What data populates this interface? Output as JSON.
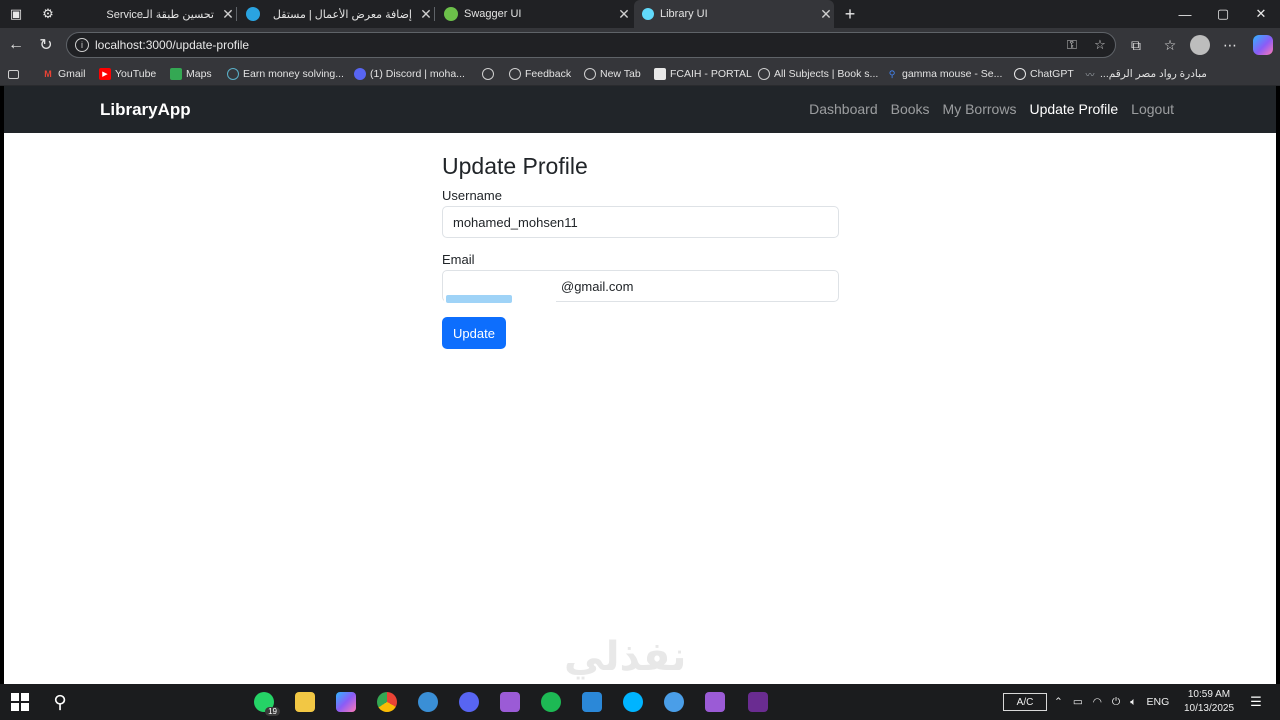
{
  "browser": {
    "tabs": [
      {
        "title": "تحسين طبقة الـService",
        "favicon_color": "#bbbbbb",
        "active": false
      },
      {
        "title": "إضافة معرض الأعمال | مستقل",
        "favicon_color": "#2aa3e0",
        "active": false
      },
      {
        "title": "Swagger UI",
        "favicon_color": "#6cc04a",
        "active": false
      },
      {
        "title": "Library UI",
        "favicon_color": "#61dafb",
        "active": true
      }
    ],
    "new_tab_glyph": "+",
    "window_controls": {
      "minimize": "—",
      "maximize": "▢",
      "close": "✕"
    },
    "address": {
      "url": "localhost:3000/update-profile",
      "info_glyph": "i"
    },
    "bookmarks": [
      {
        "label": "Gmail",
        "icon": "gmail-icon",
        "color": "#ea4335"
      },
      {
        "label": "YouTube",
        "icon": "youtube-icon",
        "color": "#ff0000"
      },
      {
        "label": "Maps",
        "icon": "maps-icon",
        "color": "#34a853"
      },
      {
        "label": "Earn money solving...",
        "icon": "globe-icon",
        "color": "#5ab0c8"
      },
      {
        "label": "(1) Discord | moha...",
        "icon": "discord-icon",
        "color": "#5865f2"
      },
      {
        "label": "",
        "icon": "globe-icon",
        "color": "#9aa0a6"
      },
      {
        "label": "Feedback",
        "icon": "globe-icon",
        "color": "#9aa0a6"
      },
      {
        "label": "New Tab",
        "icon": "globe-icon",
        "color": "#9aa0a6"
      },
      {
        "label": "FCAIH - PORTAL",
        "icon": "portal-icon",
        "color": "#e8e8e8"
      },
      {
        "label": "All Subjects | Book s...",
        "icon": "globe-icon",
        "color": "#9aa0a6"
      },
      {
        "label": "gamma mouse - Se...",
        "icon": "search-icon",
        "color": "#4285f4"
      },
      {
        "label": "ChatGPT",
        "icon": "chatgpt-icon",
        "color": "#e8e8e8"
      },
      {
        "label": "مبادرة رواد مصر الرقم...",
        "icon": "link-icon",
        "color": "#9aa0a6"
      }
    ]
  },
  "app": {
    "brand": "LibraryApp",
    "nav": [
      {
        "label": "Dashboard",
        "active": false
      },
      {
        "label": "Books",
        "active": false
      },
      {
        "label": "My Borrows",
        "active": false
      },
      {
        "label": "Update Profile",
        "active": true
      },
      {
        "label": "Logout",
        "active": false
      }
    ],
    "form": {
      "title": "Update Profile",
      "username_label": "Username",
      "username_value": "mohamed_mohsen11",
      "email_label": "Email",
      "email_value": "@gmail.com",
      "submit_label": "Update"
    },
    "colors": {
      "navbar": "#212529",
      "primary": "#0d6efd"
    }
  },
  "watermark": "نفذلي",
  "taskbar": {
    "whatsapp_badge": "19",
    "ac_label": "A/C",
    "language": "ENG",
    "time": "10:59 AM",
    "date": "10/13/2025"
  }
}
